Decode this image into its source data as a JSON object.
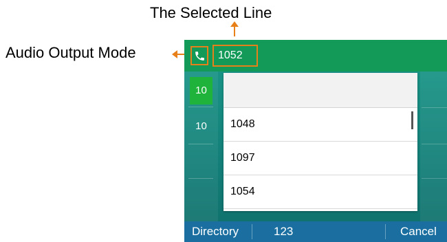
{
  "annotations": {
    "selected_line": "The Selected Line",
    "audio_output_mode": "Audio Output Mode"
  },
  "topbar": {
    "audio_icon": "handset-icon",
    "selected_line": "1052"
  },
  "line_keys": [
    "10",
    "10"
  ],
  "dropdown": {
    "items": [
      "1048",
      "1097",
      "1054"
    ]
  },
  "softkeys": [
    "Directory",
    "123",
    "Cancel"
  ],
  "colors": {
    "topbar": "#139a59",
    "highlight": "#e8801a",
    "softbar": "#1a6fa0"
  }
}
